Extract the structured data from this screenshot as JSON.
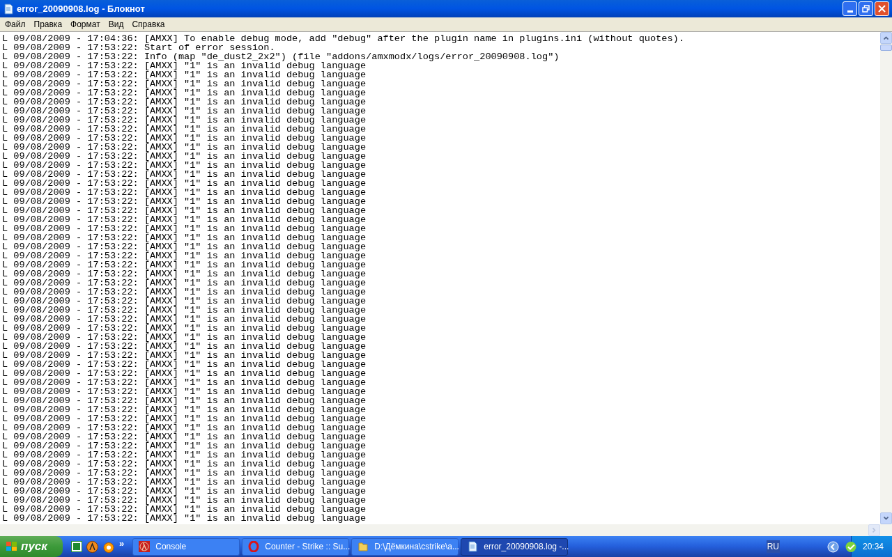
{
  "window": {
    "title": "error_20090908.log - Блокнот"
  },
  "menu": [
    "Файл",
    "Правка",
    "Формат",
    "Вид",
    "Справка"
  ],
  "lines": [
    "L 09/08/2009 - 17:04:36: [AMXX] To enable debug mode, add \"debug\" after the plugin name in plugins.ini (without quotes).",
    "L 09/08/2009 - 17:53:22: Start of error session.",
    "L 09/08/2009 - 17:53:22: Info (map \"de_dust2_2x2\") (file \"addons/amxmodx/logs/error_20090908.log\")",
    "L 09/08/2009 - 17:53:22: [AMXX] \"1\" is an invalid debug language",
    "L 09/08/2009 - 17:53:22: [AMXX] \"1\" is an invalid debug language",
    "L 09/08/2009 - 17:53:22: [AMXX] \"1\" is an invalid debug language",
    "L 09/08/2009 - 17:53:22: [AMXX] \"1\" is an invalid debug language",
    "L 09/08/2009 - 17:53:22: [AMXX] \"1\" is an invalid debug language",
    "L 09/08/2009 - 17:53:22: [AMXX] \"1\" is an invalid debug language",
    "L 09/08/2009 - 17:53:22: [AMXX] \"1\" is an invalid debug language",
    "L 09/08/2009 - 17:53:22: [AMXX] \"1\" is an invalid debug language",
    "L 09/08/2009 - 17:53:22: [AMXX] \"1\" is an invalid debug language",
    "L 09/08/2009 - 17:53:22: [AMXX] \"1\" is an invalid debug language",
    "L 09/08/2009 - 17:53:22: [AMXX] \"1\" is an invalid debug language",
    "L 09/08/2009 - 17:53:22: [AMXX] \"1\" is an invalid debug language",
    "L 09/08/2009 - 17:53:22: [AMXX] \"1\" is an invalid debug language",
    "L 09/08/2009 - 17:53:22: [AMXX] \"1\" is an invalid debug language",
    "L 09/08/2009 - 17:53:22: [AMXX] \"1\" is an invalid debug language",
    "L 09/08/2009 - 17:53:22: [AMXX] \"1\" is an invalid debug language",
    "L 09/08/2009 - 17:53:22: [AMXX] \"1\" is an invalid debug language",
    "L 09/08/2009 - 17:53:22: [AMXX] \"1\" is an invalid debug language",
    "L 09/08/2009 - 17:53:22: [AMXX] \"1\" is an invalid debug language",
    "L 09/08/2009 - 17:53:22: [AMXX] \"1\" is an invalid debug language",
    "L 09/08/2009 - 17:53:22: [AMXX] \"1\" is an invalid debug language",
    "L 09/08/2009 - 17:53:22: [AMXX] \"1\" is an invalid debug language",
    "L 09/08/2009 - 17:53:22: [AMXX] \"1\" is an invalid debug language",
    "L 09/08/2009 - 17:53:22: [AMXX] \"1\" is an invalid debug language",
    "L 09/08/2009 - 17:53:22: [AMXX] \"1\" is an invalid debug language",
    "L 09/08/2009 - 17:53:22: [AMXX] \"1\" is an invalid debug language",
    "L 09/08/2009 - 17:53:22: [AMXX] \"1\" is an invalid debug language",
    "L 09/08/2009 - 17:53:22: [AMXX] \"1\" is an invalid debug language",
    "L 09/08/2009 - 17:53:22: [AMXX] \"1\" is an invalid debug language",
    "L 09/08/2009 - 17:53:22: [AMXX] \"1\" is an invalid debug language",
    "L 09/08/2009 - 17:53:22: [AMXX] \"1\" is an invalid debug language",
    "L 09/08/2009 - 17:53:22: [AMXX] \"1\" is an invalid debug language",
    "L 09/08/2009 - 17:53:22: [AMXX] \"1\" is an invalid debug language",
    "L 09/08/2009 - 17:53:22: [AMXX] \"1\" is an invalid debug language",
    "L 09/08/2009 - 17:53:22: [AMXX] \"1\" is an invalid debug language",
    "L 09/08/2009 - 17:53:22: [AMXX] \"1\" is an invalid debug language",
    "L 09/08/2009 - 17:53:22: [AMXX] \"1\" is an invalid debug language",
    "L 09/08/2009 - 17:53:22: [AMXX] \"1\" is an invalid debug language",
    "L 09/08/2009 - 17:53:22: [AMXX] \"1\" is an invalid debug language",
    "L 09/08/2009 - 17:53:22: [AMXX] \"1\" is an invalid debug language",
    "L 09/08/2009 - 17:53:22: [AMXX] \"1\" is an invalid debug language",
    "L 09/08/2009 - 17:53:22: [AMXX] \"1\" is an invalid debug language",
    "L 09/08/2009 - 17:53:22: [AMXX] \"1\" is an invalid debug language",
    "L 09/08/2009 - 17:53:22: [AMXX] \"1\" is an invalid debug language",
    "L 09/08/2009 - 17:53:22: [AMXX] \"1\" is an invalid debug language",
    "L 09/08/2009 - 17:53:22: [AMXX] \"1\" is an invalid debug language",
    "L 09/08/2009 - 17:53:22: [AMXX] \"1\" is an invalid debug language",
    "L 09/08/2009 - 17:53:22: [AMXX] \"1\" is an invalid debug language",
    "L 09/08/2009 - 17:53:22: [AMXX] \"1\" is an invalid debug language",
    "L 09/08/2009 - 17:53:22: [AMXX] \"1\" is an invalid debug language",
    "L 09/08/2009 - 17:53:22: [AMXX] \"1\" is an invalid debug language"
  ],
  "taskbar": {
    "start": "пуск",
    "quick_launch_more": "»",
    "tasks": [
      {
        "kind": "console",
        "label": "Console",
        "selected": false
      },
      {
        "kind": "browser",
        "label": "Counter - Strike :: Su...",
        "selected": false
      },
      {
        "kind": "folder",
        "label": "D:\\Дёмкина\\cstrike\\a...",
        "selected": false
      },
      {
        "kind": "notepad",
        "label": "error_20090908.log -...",
        "selected": true
      }
    ],
    "language": "RU",
    "clock": "20:34"
  }
}
